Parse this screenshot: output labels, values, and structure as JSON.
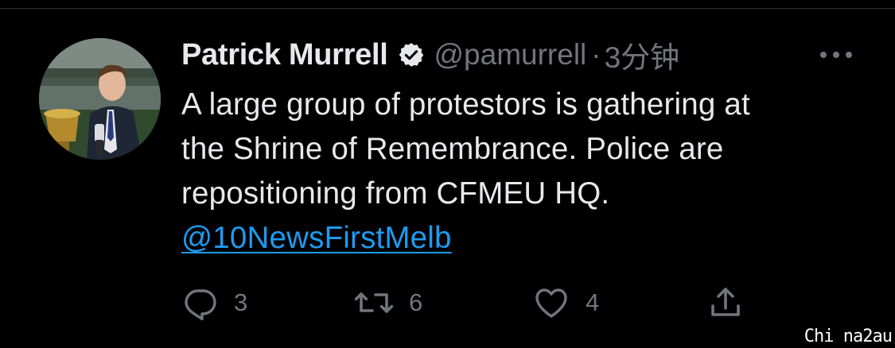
{
  "tweet": {
    "author": {
      "display_name": "Patrick Murrell",
      "handle": "@pamurrell",
      "verified": true,
      "avatar_icon": "profile-photo"
    },
    "separator": "·",
    "time": "3分钟",
    "body_lines": [
      "A large group of protestors is gathering at",
      "the Shrine of Remembrance. Police are",
      "repositioning from CFMEU HQ."
    ],
    "mention": "@10NewsFirstMelb",
    "actions": {
      "reply_count": "3",
      "retweet_count": "6",
      "like_count": "4"
    }
  },
  "watermark": "Chi na2au",
  "colors": {
    "background": "#000000",
    "text": "#e7e9ea",
    "muted": "#71767b",
    "link": "#1d9bf0"
  }
}
